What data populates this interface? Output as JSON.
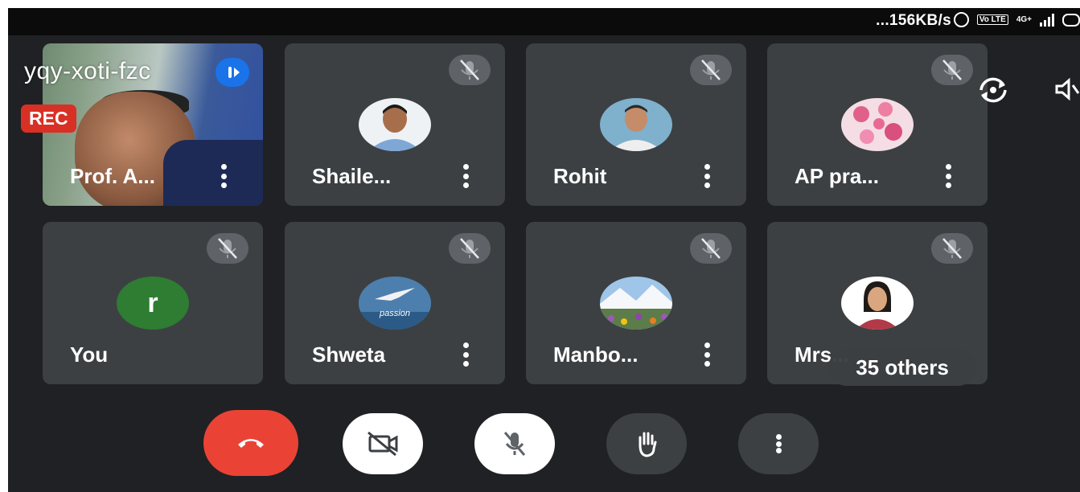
{
  "status_bar": {
    "network_speed": "...156KB/s",
    "volte": "Vo LTE",
    "network": "4G+",
    "icons": [
      "alarm-icon",
      "volte-icon",
      "signal-icon",
      "battery-icon"
    ]
  },
  "meeting": {
    "code": "yqy-xoti-fzc",
    "recording_label": "REC"
  },
  "participants": [
    {
      "name": "Prof. A...",
      "avatar": "video-feed",
      "muted": false
    },
    {
      "name": "Shaile...",
      "avatar": "photo",
      "muted": true
    },
    {
      "name": "Rohit",
      "avatar": "photo",
      "muted": true
    },
    {
      "name": "AP pra...",
      "avatar": "flower-photo",
      "muted": true
    },
    {
      "name": "You",
      "avatar_letter": "r",
      "avatar_color": "#2e7d32",
      "muted": true
    },
    {
      "name": "Shweta",
      "avatar": "bird-photo",
      "avatar_caption": "passion",
      "muted": true
    },
    {
      "name": "Manbo...",
      "avatar": "landscape-photo",
      "muted": true
    },
    {
      "name": "Mrs...",
      "avatar": "photo",
      "muted": true
    }
  ],
  "others_count_label": "35 others",
  "controls": [
    "end-call",
    "camera-off",
    "mic-off",
    "raise-hand",
    "more-options"
  ],
  "colors": {
    "background": "#202124",
    "tile": "#3c4043",
    "end_call": "#ea4335",
    "record": "#d93025",
    "audio_indicator": "#1a73e8"
  }
}
